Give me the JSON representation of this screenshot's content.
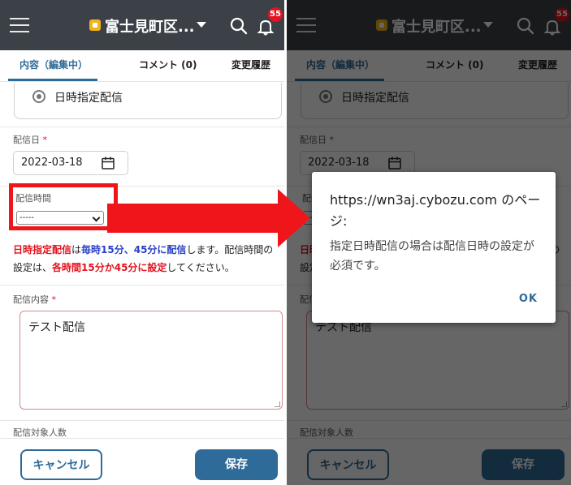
{
  "header": {
    "app_title": "富士見町区...",
    "notification_count": "55"
  },
  "tabs": [
    {
      "label": "内容（編集中）"
    },
    {
      "label": "コメント (0)"
    },
    {
      "label": "変更履歴"
    }
  ],
  "form": {
    "delivery_type_option": "日時指定配信",
    "date_label": "配信日",
    "date_value": "2022-03-18",
    "time_label": "配信時間",
    "time_value": "-----",
    "note": {
      "part1": "日時指定配信",
      "part2": "は",
      "part3": "毎時15分、45分に配信",
      "part4": "します。配信時間の設定は、",
      "part5": "各時間15分か45分に設定",
      "part6": "してください。"
    },
    "content_label": "配信内容",
    "content_value": "テスト配信",
    "recipients_label": "配信対象人数",
    "required_mark": "*"
  },
  "buttons": {
    "cancel": "キャンセル",
    "save": "保存"
  },
  "dialog": {
    "title": "https://wn3aj.cybozu.com のページ:",
    "message": "指定日時配信の場合は配信日時の設定が必須です。",
    "ok": "OK"
  },
  "colors": {
    "header_bg": "#3c4148",
    "accent": "#2f6b98",
    "alert_red": "#f0141b",
    "note_blue": "#2a40c8"
  }
}
